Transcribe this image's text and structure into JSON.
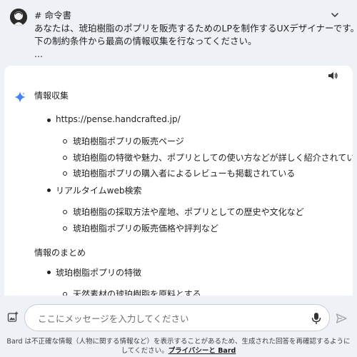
{
  "prompt": {
    "lines": [
      "# 命令書",
      "あなたは、琥珀樹脂のポプリを販売するためのLPを制作するUXデザイナーです。以",
      "下の制約条件から最高の情報収集を行なってください。",
      "..."
    ]
  },
  "icons": {
    "avatar": "avatar-icon",
    "expand": "chevron-down-icon",
    "speaker": "speaker-icon",
    "sparkle": "bard-sparkle-icon",
    "image": "add-image-icon",
    "mic": "microphone-icon",
    "send": "send-icon"
  },
  "colors": {
    "sparkle_blue": "#4285f4",
    "sparkle_light": "#9ec1f7",
    "background": "#eef1f6"
  },
  "response": {
    "heading": "情報収集",
    "items": [
      "https://pense.handcrafted.jp/",
      "琥珀樹脂ポプリの販売ページ",
      "琥珀樹脂の特徴や魅力、ポプリとしての使い方などが詳しく紹介されている",
      "琥珀樹脂ポプリの購入者によるレビューも掲載されている",
      "リアルタイムweb検索",
      "琥珀樹脂の採取方法や産地、ポプリとしての歴史や文化など",
      "琥珀樹脂ポプリの販売価格や評判など"
    ],
    "summary_heading": "情報のまとめ",
    "summary_items": [
      "琥珀樹脂ポプリの特徴",
      "天然素材の琥珀樹脂を原料とする"
    ]
  },
  "composer": {
    "placeholder": "ここにメッセージを入力してください"
  },
  "footer": {
    "disclaimer": "Bard は不正確な情報（人物に関する情報など）を表示することがあるため、生成された回答を再確認するようにしてください。",
    "link": "プライバシーと Bard"
  }
}
